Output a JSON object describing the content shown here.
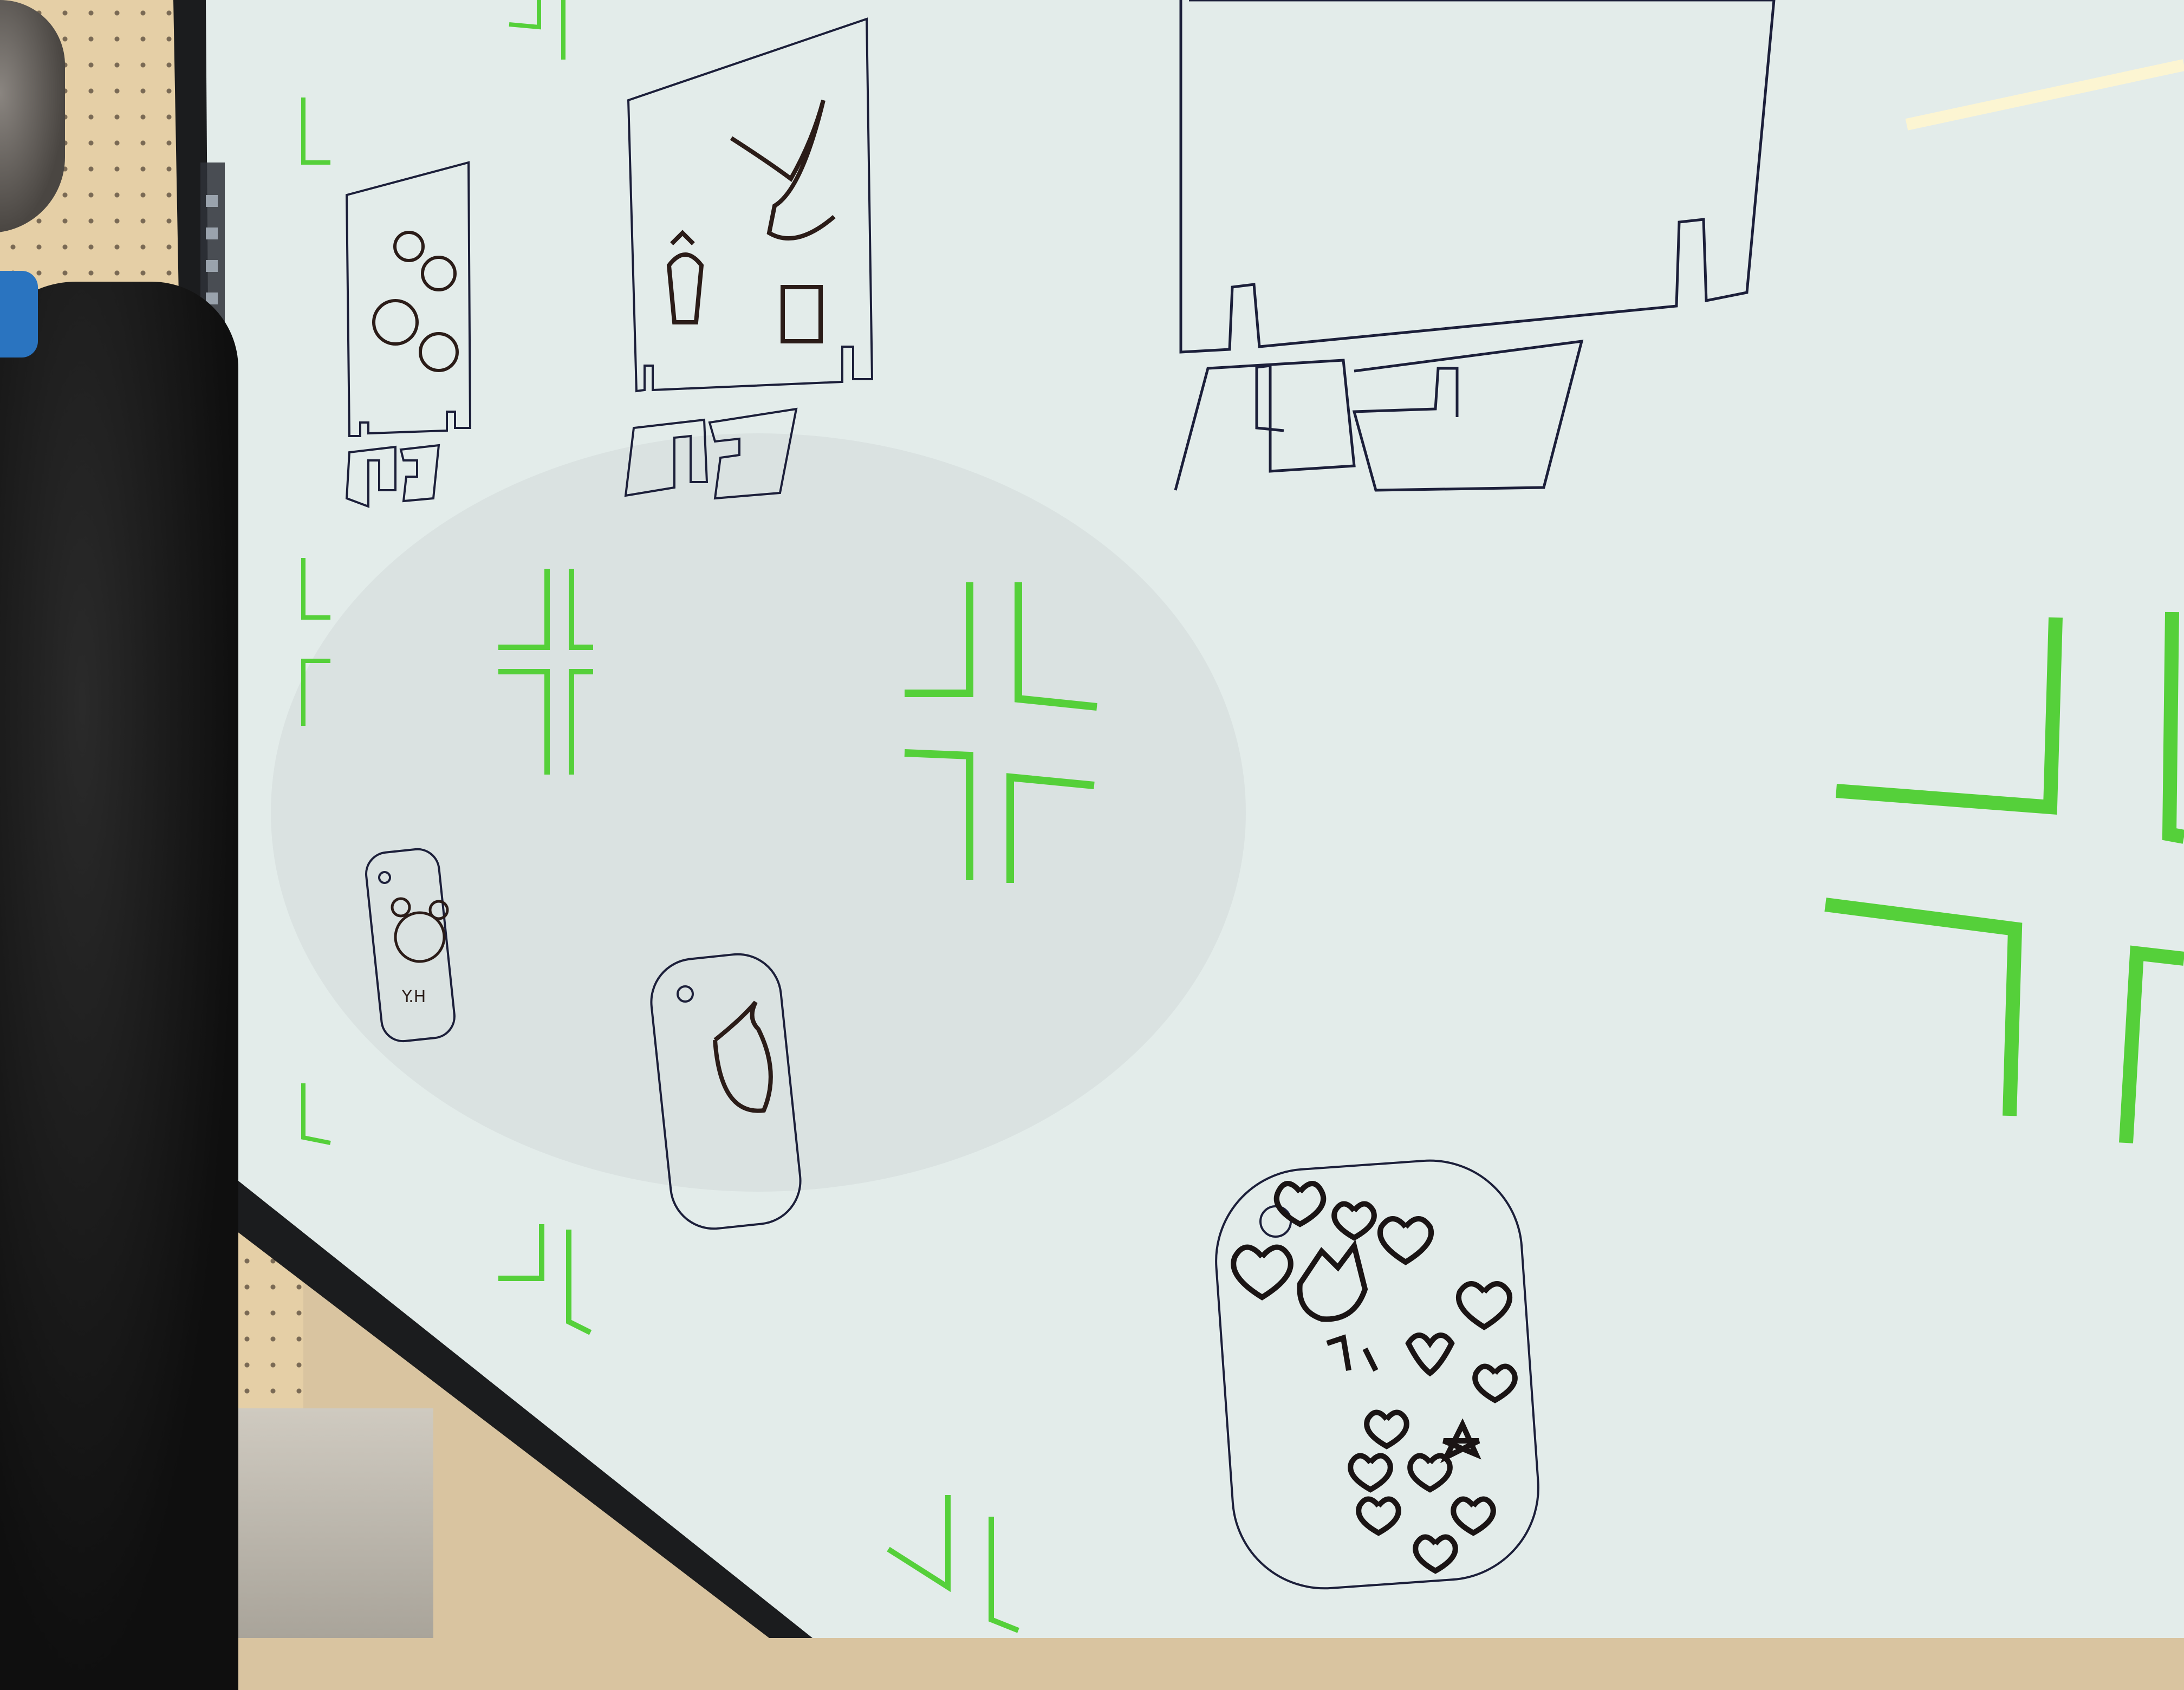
{
  "scene": {
    "description_tags": [
      "monitor-bezel",
      "laser-cut-layout-canvas",
      "pegboard",
      "person"
    ],
    "colors": {
      "screen": "#e3ecea",
      "bezel": "#1b1c1e",
      "cut_line": "#1c1f3a",
      "registration_mark": "#55d03a",
      "drawing_ink": "#2b1c18"
    }
  },
  "drawings": {
    "keychain_bear_initials": "Y.H"
  },
  "icons": [
    "registration-mark-icon",
    "bird-silhouette-icon"
  ]
}
